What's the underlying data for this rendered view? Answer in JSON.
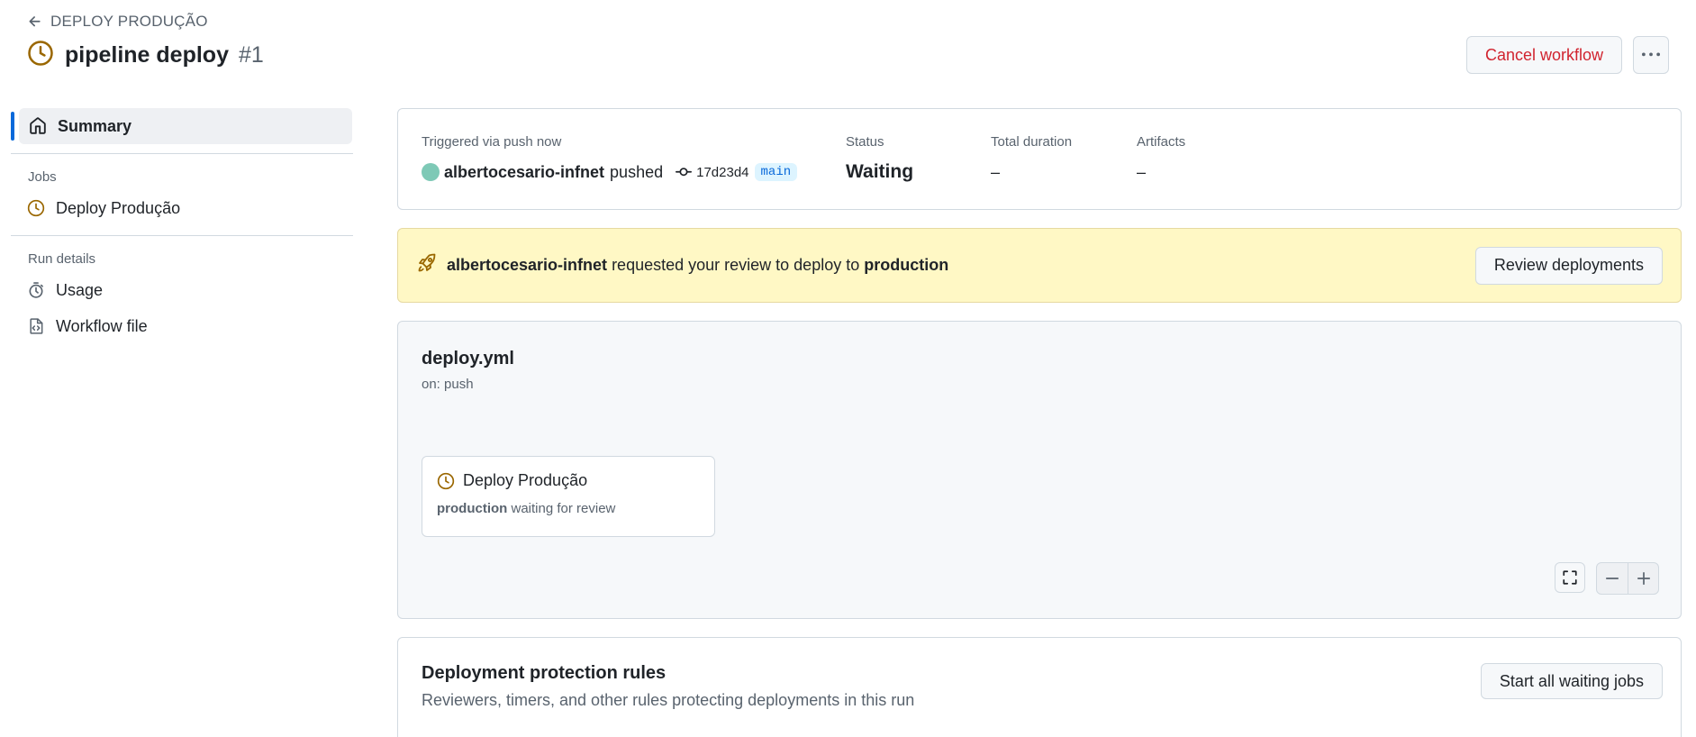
{
  "header": {
    "back_label": "DEPLOY PRODUÇÃO",
    "title": "pipeline deploy",
    "run_number": "#1",
    "cancel_label": "Cancel workflow",
    "more_icon": "kebab-horizontal-icon"
  },
  "sidebar": {
    "summary_label": "Summary",
    "jobs_heading": "Jobs",
    "jobs": [
      {
        "label": "Deploy Produção",
        "icon": "clock-icon"
      }
    ],
    "run_details_heading": "Run details",
    "details": [
      {
        "label": "Usage",
        "icon": "stopwatch-icon"
      },
      {
        "label": "Workflow file",
        "icon": "file-code-icon"
      }
    ]
  },
  "summary": {
    "trigger_label": "Triggered via push now",
    "actor": "albertocesario-infnet",
    "action": "pushed",
    "sha": "17d23d4",
    "branch": "main",
    "status_label": "Status",
    "status_value": "Waiting",
    "duration_label": "Total duration",
    "duration_value": "–",
    "artifacts_label": "Artifacts",
    "artifacts_value": "–"
  },
  "review": {
    "actor": "albertocesario-infnet",
    "text": "requested your review to deploy to",
    "environment": "production",
    "button_label": "Review deployments"
  },
  "graph": {
    "workflow_file": "deploy.yml",
    "trigger": "on: push",
    "job": {
      "name": "Deploy Produção",
      "environment": "production",
      "status_text": "waiting for review"
    }
  },
  "rules": {
    "title": "Deployment protection rules",
    "description": "Reviewers, timers, and other rules protecting deployments in this run",
    "button_label": "Start all waiting jobs"
  },
  "colors": {
    "accent": "#0969da",
    "waiting": "#9a6700",
    "danger": "#d1242f",
    "banner": "#fff8c5"
  }
}
